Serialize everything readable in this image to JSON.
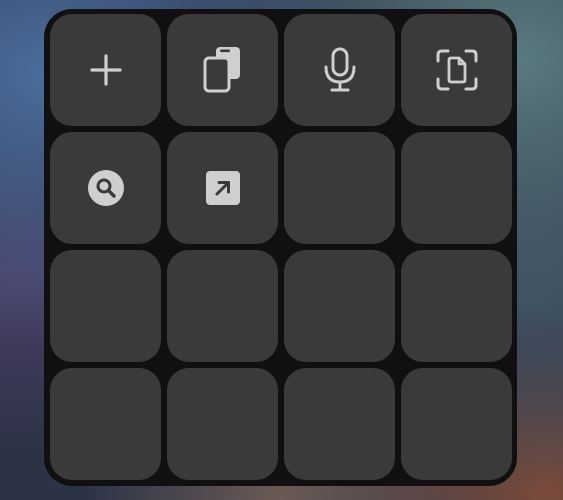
{
  "colors": {
    "panel_background": "#101010",
    "tile_background": "#3a3a3a",
    "icon_color": "#cfcfcf"
  },
  "tiles": [
    {
      "icon": "plus-icon"
    },
    {
      "icon": "copy-documents-icon"
    },
    {
      "icon": "microphone-icon"
    },
    {
      "icon": "scan-document-icon"
    },
    {
      "icon": "search-icon"
    },
    {
      "icon": "open-external-icon"
    },
    {
      "icon": ""
    },
    {
      "icon": ""
    },
    {
      "icon": ""
    },
    {
      "icon": ""
    },
    {
      "icon": ""
    },
    {
      "icon": ""
    },
    {
      "icon": ""
    },
    {
      "icon": ""
    },
    {
      "icon": ""
    },
    {
      "icon": ""
    }
  ]
}
